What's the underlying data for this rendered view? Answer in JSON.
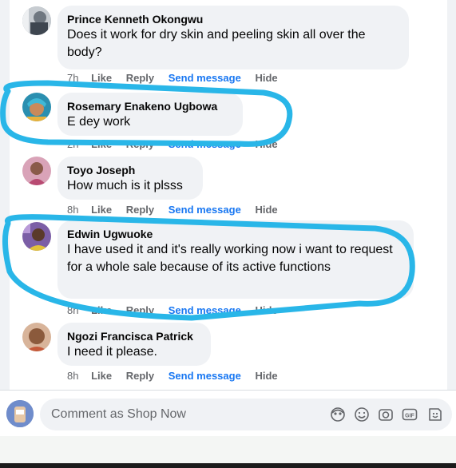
{
  "comments": [
    {
      "author": "Prince Kenneth Okongwu",
      "text": "Does it work for dry skin and peeling skin all over the body?",
      "time": "7h",
      "like": "Like",
      "reply": "Reply",
      "send": "Send message",
      "hide": "Hide"
    },
    {
      "author": "Rosemary Enakeno Ugbowa",
      "text": "E dey work",
      "time": "2h",
      "like": "Like",
      "reply": "Reply",
      "send": "Send message",
      "hide": "Hide"
    },
    {
      "author": "Toyo Joseph",
      "text": "How much is it plsss",
      "time": "8h",
      "like": "Like",
      "reply": "Reply",
      "send": "Send message",
      "hide": "Hide"
    },
    {
      "author": "Edwin Ugwuoke",
      "text": "I have used it and it's really working now i want to request for a whole sale because of its active functions",
      "time": "8h",
      "like": "Like",
      "reply": "Reply",
      "send": "Send message",
      "hide": "Hide"
    },
    {
      "author": "Ngozi Francisca Patrick",
      "text": "I need it please.",
      "time": "8h",
      "like": "Like",
      "reply": "Reply",
      "send": "Send message",
      "hide": "Hide"
    }
  ],
  "composer": {
    "placeholder": "Comment as Shop Now",
    "icons": [
      "avatar-sticker-icon",
      "emoji-icon",
      "camera-icon",
      "gif-icon",
      "sticker-icon"
    ]
  },
  "colors": {
    "link": "#1877f2",
    "highlight": "#29b6e8",
    "bubble": "#f0f2f5"
  }
}
